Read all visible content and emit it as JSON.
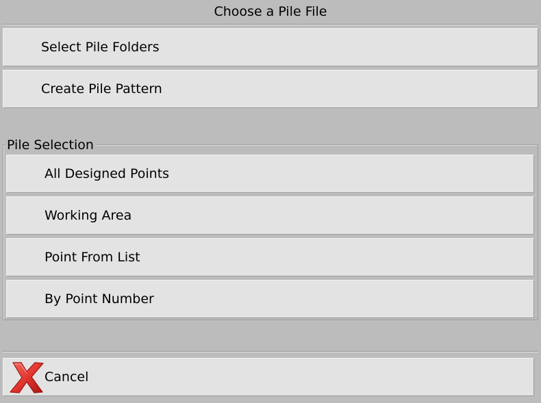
{
  "window": {
    "title": "Choose a Pile File"
  },
  "actions": {
    "select_pile_folders": "Select Pile Folders",
    "create_pile_pattern": "Create Pile Pattern"
  },
  "pile_selection": {
    "group_label": "Pile Selection",
    "options": [
      "All Designed Points",
      "Working Area",
      "Point From List",
      "By Point Number"
    ]
  },
  "footer": {
    "cancel_label": "Cancel",
    "cancel_icon": "red-x-icon"
  },
  "colors": {
    "background": "#bcbcbc",
    "button": "#e3e3e3",
    "cancel_icon_red": "#e0322c"
  }
}
